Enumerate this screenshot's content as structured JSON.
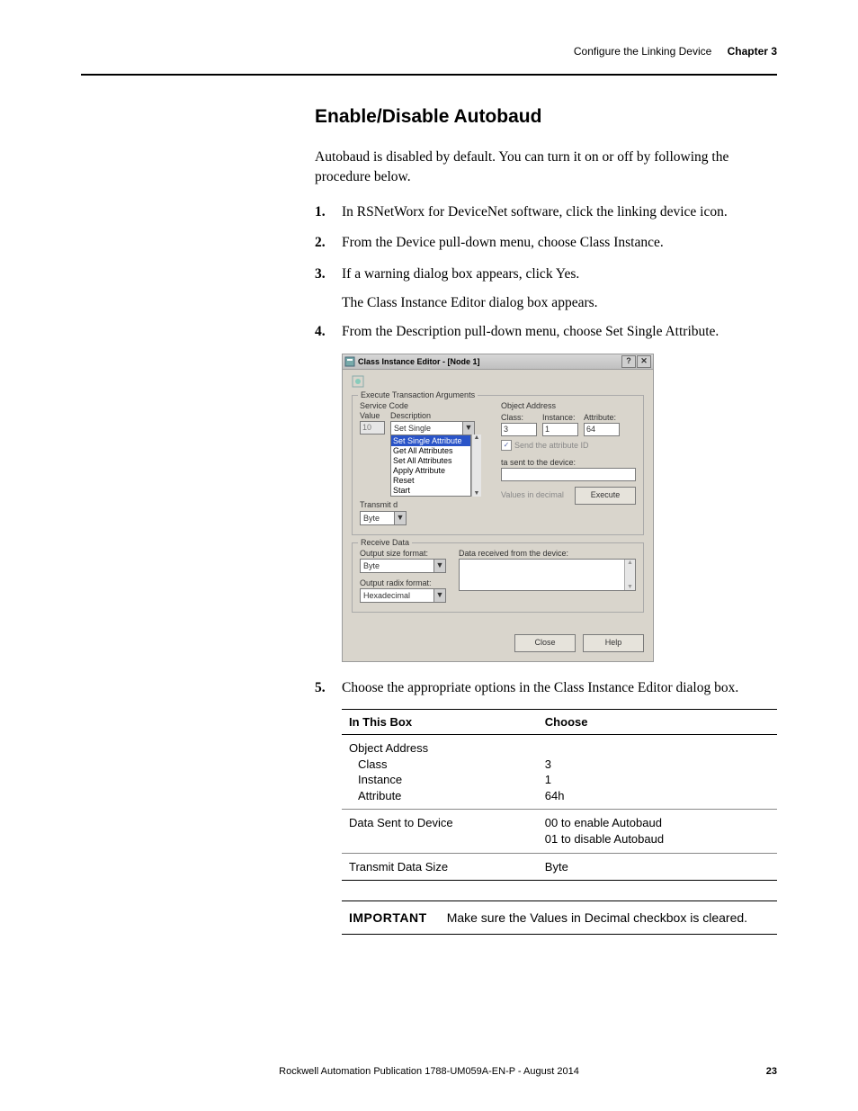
{
  "header": {
    "title": "Configure the Linking Device",
    "chapter": "Chapter 3"
  },
  "section": {
    "heading": "Enable/Disable Autobaud"
  },
  "intro": "Autobaud is disabled by default. You can turn it on or off by following the procedure below.",
  "steps": {
    "s1": "In RSNetWorx for DeviceNet software, click the linking device icon.",
    "s2": "From the Device pull-down menu, choose Class Instance.",
    "s3": "If a warning dialog box appears, click Yes.",
    "s3_sub": "The Class Instance Editor dialog box appears.",
    "s4": "From the Description pull-down menu, choose Set Single Attribute.",
    "s5": "Choose the appropriate options in the Class Instance Editor dialog box."
  },
  "dialog": {
    "title": "Class Instance Editor - [Node 1]",
    "help_btn": "?",
    "close_btn": "✕",
    "group_exec": "Execute Transaction Arguments",
    "service_code_lbl": "Service Code",
    "value_lbl": "Value",
    "value_val": "10",
    "description_lbl": "Description",
    "desc_dd": "Set Single Attribute",
    "list": {
      "sel": "Set Single Attribute",
      "i1": "Get All Attributes",
      "i2": "Set All Attributes",
      "i3": "Apply Attribute",
      "i4": "Reset",
      "i5": "Start"
    },
    "transmit_lbl": "Transmit d",
    "transmit_dd": "Byte",
    "obj_addr": "Object Address",
    "class_lbl": "Class:",
    "class_val": "3",
    "instance_lbl": "Instance:",
    "instance_val": "1",
    "attribute_lbl": "Attribute:",
    "attribute_val": "64",
    "send_attr_chk": "Send the attribute ID",
    "data_sent_lbl": "ta sent to the device:",
    "values_dec": "Values in decimal",
    "execute_btn": "Execute",
    "group_recv": "Receive Data",
    "out_size_lbl": "Output size format:",
    "out_size_val": "Byte",
    "out_radix_lbl": "Output radix format:",
    "out_radix_val": "Hexadecimal",
    "data_recv_lbl": "Data received from the device:",
    "close_btn_label": "Close",
    "help_btn_label": "Help"
  },
  "table": {
    "h1": "In This Box",
    "h2": "Choose",
    "r1c1": "Object Address",
    "r1c1a": "Class",
    "r1c1b": "Instance",
    "r1c1c": "Attribute",
    "r1c2a": "3",
    "r1c2b": "1",
    "r1c2c": "64h",
    "r2c1": "Data Sent to Device",
    "r2c2a": "00 to enable Autobaud",
    "r2c2b": "01 to disable Autobaud",
    "r3c1": "Transmit Data Size",
    "r3c2": "Byte"
  },
  "important": {
    "label": "IMPORTANT",
    "text": "Make sure the Values in Decimal checkbox is cleared."
  },
  "footer": {
    "pub": "Rockwell Automation Publication 1788-UM059A-EN-P - August 2014",
    "page": "23"
  }
}
